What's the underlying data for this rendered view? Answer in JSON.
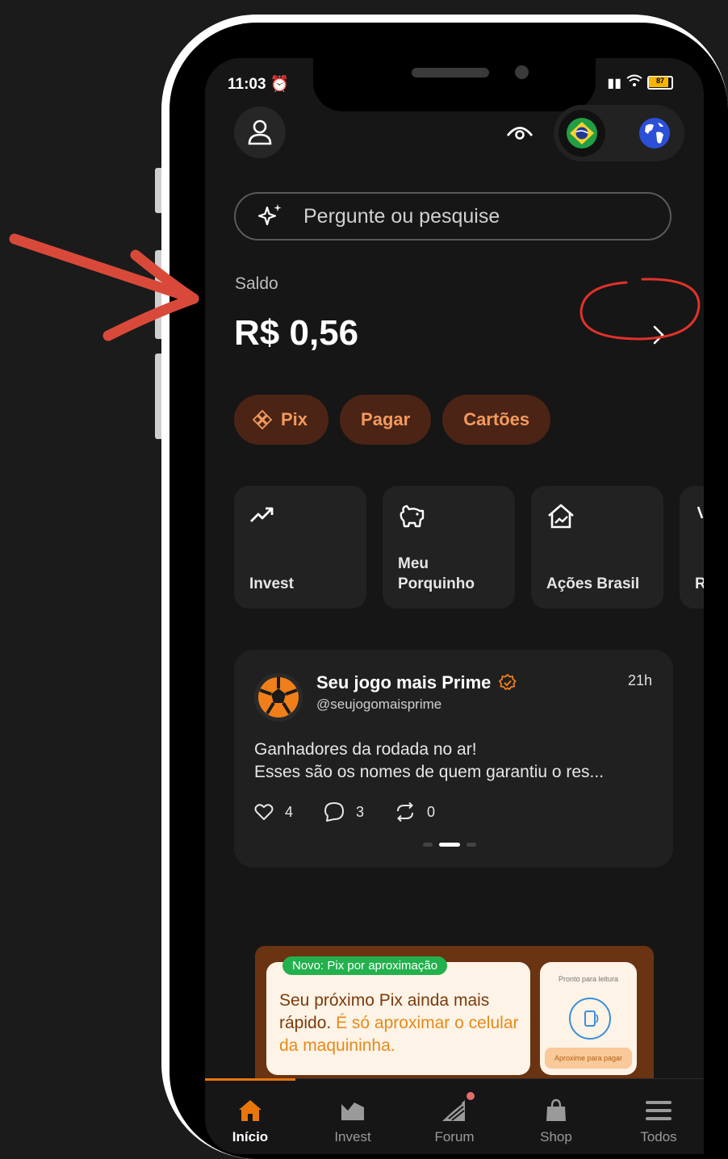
{
  "status_bar": {
    "time": "11:03",
    "battery": "87"
  },
  "search": {
    "placeholder": "Pergunte ou pesquise"
  },
  "balance": {
    "label": "Saldo",
    "value": "R$ 0,56"
  },
  "quick_actions": [
    {
      "label": "Pix"
    },
    {
      "label": "Pagar"
    },
    {
      "label": "Cartões"
    }
  ],
  "shortcuts": [
    {
      "label": "Invest",
      "icon": "trending-up-icon"
    },
    {
      "label": "Meu\nPorquinho",
      "icon": "piggy-bank-icon"
    },
    {
      "label": "Ações Brasil",
      "icon": "home-chart-icon"
    },
    {
      "label": "R",
      "icon": "partial-icon"
    }
  ],
  "post": {
    "author": "Seu jogo mais Prime",
    "handle": "@seujogomaisprime",
    "time": "21h",
    "line1": "Ganhadores da rodada no ar!",
    "line2": "Esses são os nomes de quem garantiu o res...",
    "likes": "4",
    "comments": "3",
    "reposts": "0"
  },
  "banner": {
    "badge": "Novo: Pix por aproximação",
    "text_main": "Seu próximo Pix ainda mais rápido.",
    "text_highlight": "É só aproximar o celular da maquininha.",
    "side_top": "Pronto para leitura",
    "side_button": "Aproxime para pagar"
  },
  "tabs": [
    {
      "label": "Início",
      "active": true
    },
    {
      "label": "Invest"
    },
    {
      "label": "Forum"
    },
    {
      "label": "Shop"
    },
    {
      "label": "Todos"
    }
  ],
  "colors": {
    "accent": "#e8760b",
    "chip_bg": "#4b2415",
    "chip_text": "#f29a5e",
    "annotation": "#d9493a"
  }
}
